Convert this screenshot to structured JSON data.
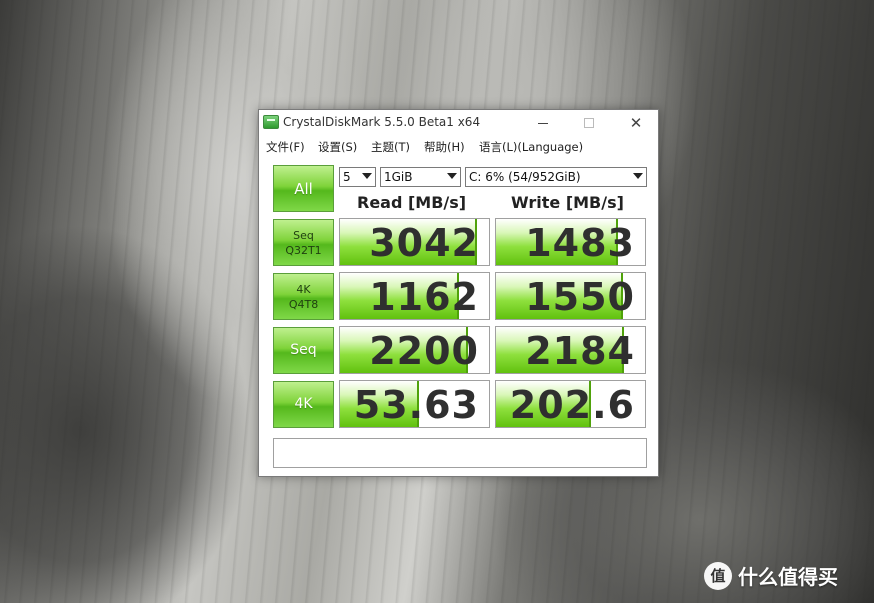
{
  "window": {
    "title": "CrystalDiskMark 5.5.0 Beta1 x64",
    "menu": [
      "文件(F)",
      "设置(S)",
      "主题(T)",
      "帮助(H)",
      "语言(L)(Language)"
    ]
  },
  "controls": {
    "all_label": "All",
    "test_count": "5",
    "test_size": "1GiB",
    "drive": "C: 6% (54/952GiB)"
  },
  "headers": {
    "read": "Read [MB/s]",
    "write": "Write [MB/s]"
  },
  "rows": [
    {
      "line1": "Seq",
      "line2": "Q32T1",
      "read": "3042",
      "write": "1483",
      "read_fill_pct": 92,
      "write_fill_pct": 82
    },
    {
      "line1": "4K",
      "line2": "Q4T8",
      "read": "1162",
      "write": "1550",
      "read_fill_pct": 80,
      "write_fill_pct": 85
    },
    {
      "line1": "Seq",
      "line2": "",
      "read": "2200",
      "write": "2184",
      "read_fill_pct": 86,
      "write_fill_pct": 86
    },
    {
      "line1": "4K",
      "line2": "",
      "read": "53.63",
      "write": "202.6",
      "read_fill_pct": 53,
      "write_fill_pct": 64
    }
  ],
  "status_text": "",
  "watermark": {
    "badge": "值",
    "text": "什么值得买"
  },
  "colors": {
    "accent": "#6cc91c",
    "button_border": "#5a9e3a"
  }
}
